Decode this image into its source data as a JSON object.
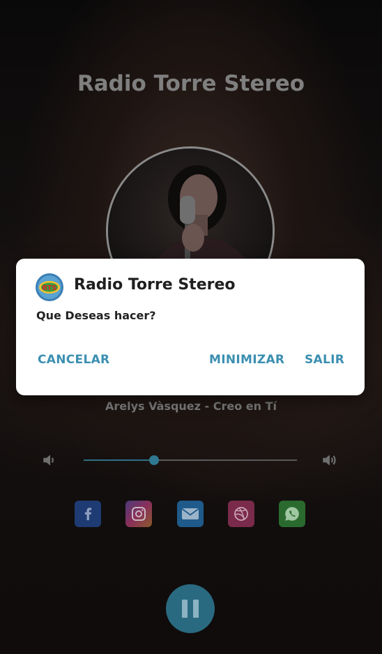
{
  "app": {
    "title": "Radio Torre Stereo"
  },
  "player": {
    "track": "Arelys Vàsquez - Creo en Tí",
    "volume_percent": 33
  },
  "social": [
    "facebook-icon",
    "instagram-icon",
    "email-icon",
    "dribbble-icon",
    "whatsapp-icon"
  ],
  "dialog": {
    "title": "Radio Torre Stereo",
    "logo_text": "RTS",
    "message": "Que Deseas hacer?",
    "cancel_label": "CANCELAR",
    "minimize_label": "MINIMIZAR",
    "exit_label": "SALIR"
  },
  "colors": {
    "accent": "#3b8fb0",
    "play_button": "#2a6a80"
  }
}
